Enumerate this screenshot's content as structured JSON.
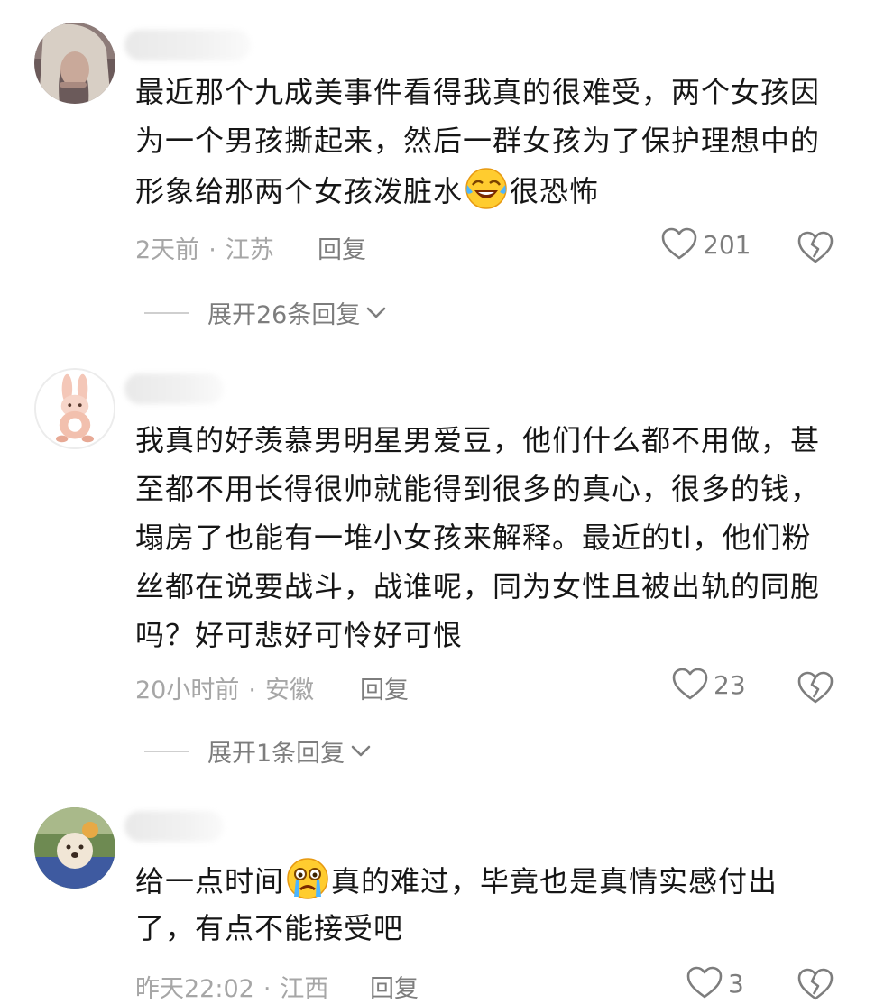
{
  "comments": [
    {
      "lines": [
        "最近那个九成美事件看得我真的很难受，两个女孩因",
        "为一个男孩撕起来，然后一群女孩为了保护理想中的"
      ],
      "line3_before": "形象给那两个女孩泼脏水",
      "line3_emoji": "laughing-crying-emoji",
      "line3_after": "很恐怖",
      "time": "2天前",
      "location": "江苏",
      "reply_label": "回复",
      "likes": "201",
      "expand_label": "展开26条回复"
    },
    {
      "lines": [
        "我真的好羡慕男明星男爱豆，他们什么都不用做，甚",
        "至都不用长得很帅就能得到很多的真心，很多的钱，",
        "塌房了也能有一堆小女孩来解释。最近的tl，他们粉",
        "丝都在说要战斗，战谁呢，同为女性且被出轨的同胞",
        "吗？好可悲好可怜好可恨"
      ],
      "time": "20小时前",
      "location": "安徽",
      "reply_label": "回复",
      "likes": "23",
      "expand_label": "展开1条回复"
    },
    {
      "line1_before": "给一点时间",
      "line1_emoji": "crying-emoji",
      "line1_after": "真的难过，毕竟也是真情实感付出",
      "lines": [
        "了，有点不能接受吧"
      ],
      "time": "昨天22:02",
      "location": "江西",
      "reply_label": "回复",
      "likes": "3"
    }
  ]
}
